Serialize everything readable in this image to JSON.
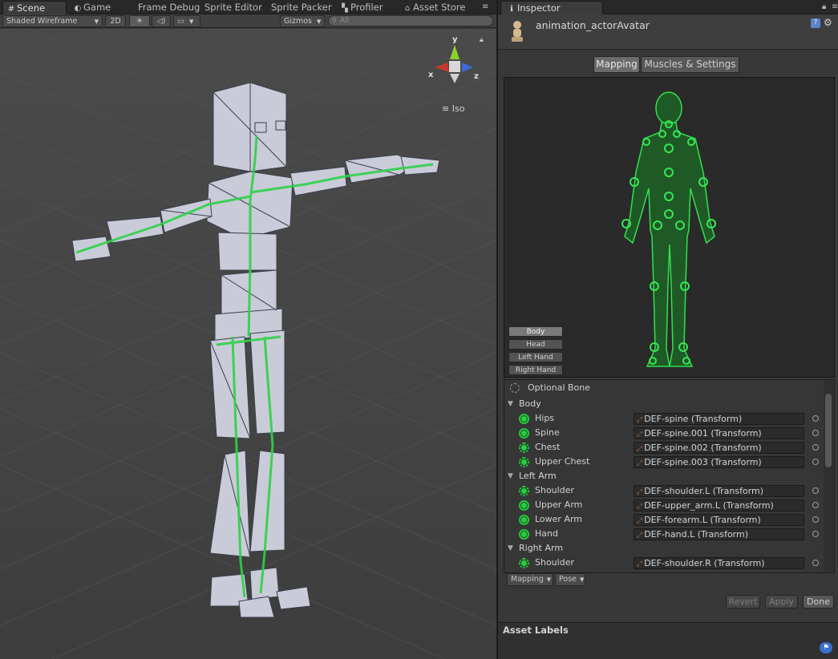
{
  "scene_tabs": {
    "scene": "Scene",
    "game": "Game",
    "frame_debug": "Frame Debug",
    "sprite_editor": "Sprite Editor",
    "sprite_packer": "Sprite Packer",
    "profiler": "Profiler",
    "asset_store": "Asset Store"
  },
  "scene_toolbar": {
    "draw_mode": "Shaded Wireframe",
    "two_d": "2D",
    "gizmos": "Gizmos",
    "search_placeholder": "All"
  },
  "gizmo": {
    "y": "y",
    "x": "x",
    "z": "z",
    "projection": "Iso"
  },
  "inspector": {
    "tab": "Inspector",
    "asset_name": "animation_actorAvatar",
    "mode_tabs": [
      "Mapping",
      "Muscles & Settings"
    ],
    "part_buttons": [
      "Body",
      "Head",
      "Left Hand",
      "Right Hand"
    ],
    "optional_bone": "Optional Bone",
    "groups": [
      {
        "name": "Body",
        "bones": [
          {
            "name": "Hips",
            "transform": "DEF-spine (Transform)"
          },
          {
            "name": "Spine",
            "transform": "DEF-spine.001 (Transform)"
          },
          {
            "name": "Chest",
            "transform": "DEF-spine.002 (Transform)"
          },
          {
            "name": "Upper Chest",
            "transform": "DEF-spine.003 (Transform)"
          }
        ]
      },
      {
        "name": "Left Arm",
        "bones": [
          {
            "name": "Shoulder",
            "transform": "DEF-shoulder.L (Transform)"
          },
          {
            "name": "Upper Arm",
            "transform": "DEF-upper_arm.L (Transform)"
          },
          {
            "name": "Lower Arm",
            "transform": "DEF-forearm.L (Transform)"
          },
          {
            "name": "Hand",
            "transform": "DEF-hand.L (Transform)"
          }
        ]
      },
      {
        "name": "Right Arm",
        "bones": [
          {
            "name": "Shoulder",
            "transform": "DEF-shoulder.R (Transform)"
          }
        ]
      }
    ],
    "bottom_dropdowns": [
      "Mapping",
      "Pose"
    ],
    "actions": [
      "Revert",
      "Apply",
      "Done"
    ],
    "asset_labels": "Asset Labels"
  },
  "colors": {
    "bone_green": "#22c93a",
    "panel_bg": "#383838",
    "scene_bg": "#454545"
  }
}
